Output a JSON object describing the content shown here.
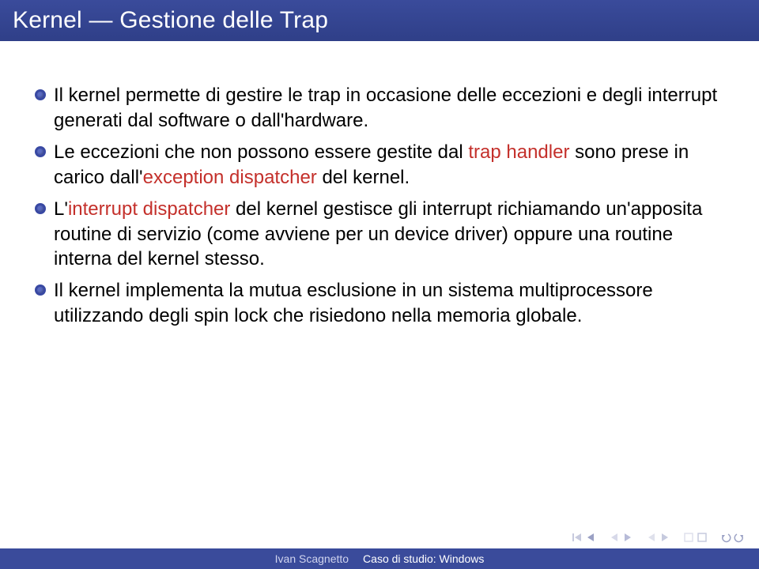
{
  "title": "Kernel — Gestione delle Trap",
  "bullets": [
    {
      "segments": [
        {
          "t": "Il kernel permette di gestire le trap in occasione delle eccezioni e degli interrupt generati dal software o dall'hardware.",
          "red": false
        }
      ]
    },
    {
      "segments": [
        {
          "t": "Le eccezioni che non possono essere gestite dal ",
          "red": false
        },
        {
          "t": "trap handler",
          "red": true
        },
        {
          "t": " sono prese in carico dall'",
          "red": false
        },
        {
          "t": "exception dispatcher",
          "red": true
        },
        {
          "t": " del kernel.",
          "red": false
        }
      ]
    },
    {
      "segments": [
        {
          "t": "L'",
          "red": false
        },
        {
          "t": "interrupt dispatcher",
          "red": true
        },
        {
          "t": " del kernel gestisce gli interrupt richiamando un'apposita routine di servizio (come avviene per un device driver) oppure una routine interna del kernel stesso.",
          "red": false
        }
      ]
    },
    {
      "segments": [
        {
          "t": "Il kernel implementa la mutua esclusione in un sistema multiprocessore utilizzando degli spin lock che risiedono nella memoria globale.",
          "red": false
        }
      ]
    }
  ],
  "footer": {
    "author": "Ivan Scagnetto",
    "topic": "Caso di studio: Windows"
  },
  "colors": {
    "brand": "#3a4b9b",
    "accent_red": "#c4302b"
  }
}
